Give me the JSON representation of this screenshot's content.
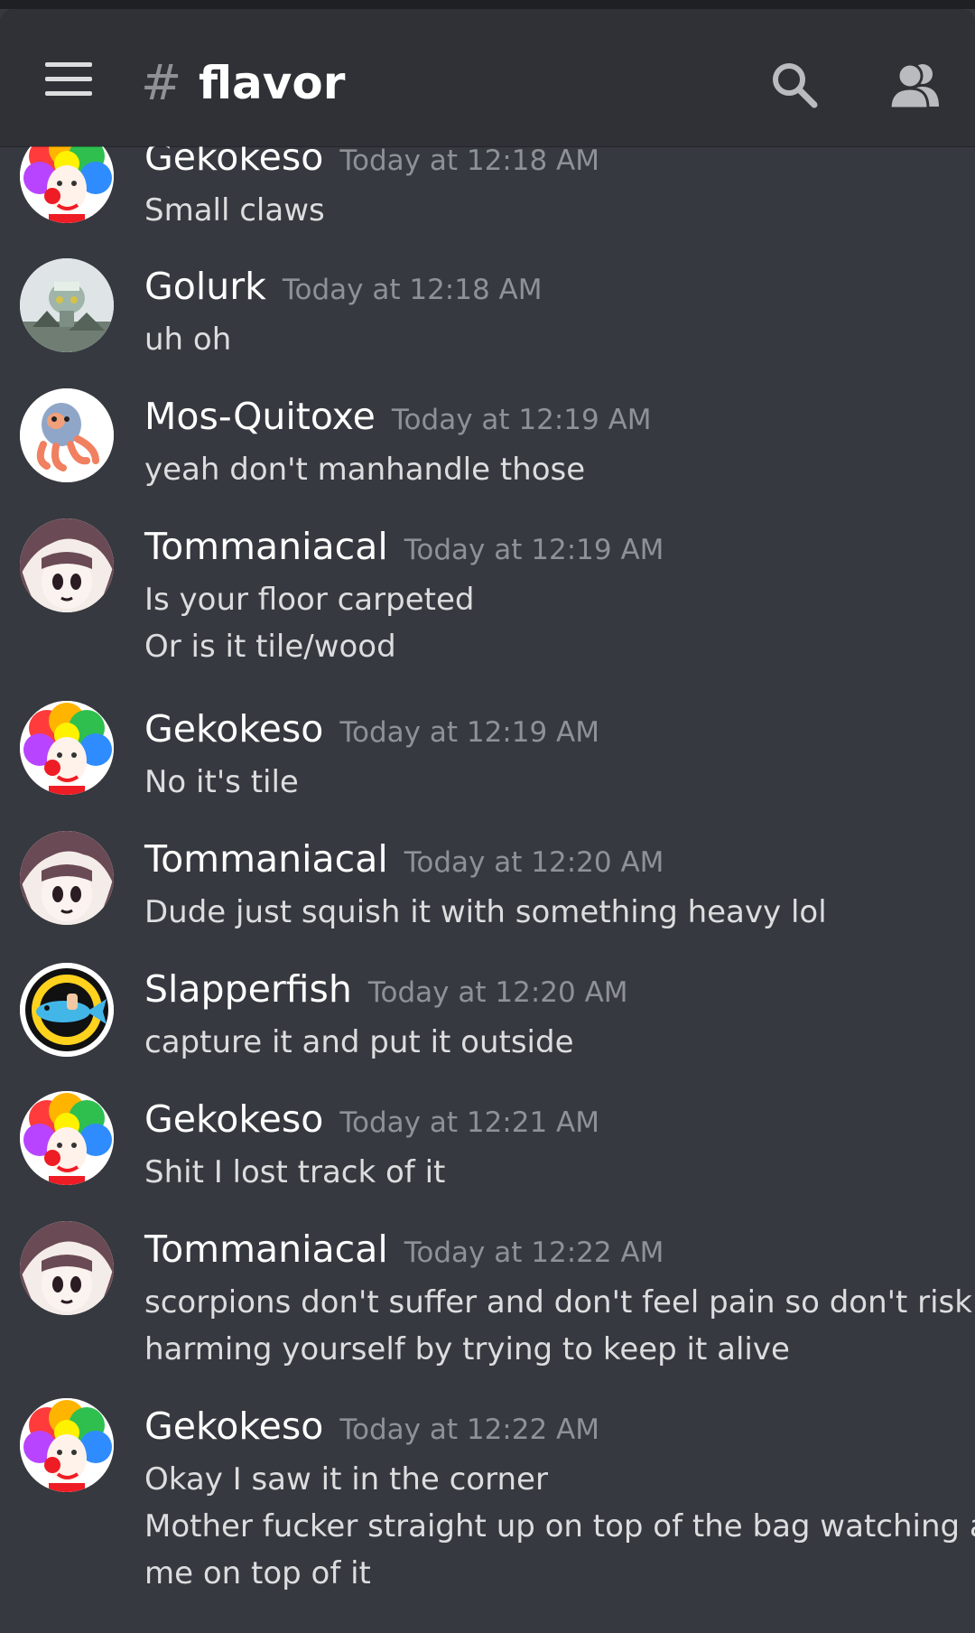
{
  "header": {
    "hash_symbol": "#",
    "channel_name": "flavor",
    "icons": [
      "hamburger-menu-icon",
      "search-icon",
      "members-icon"
    ]
  },
  "colors": {
    "background": "#36393f",
    "header_bg": "#2f3136",
    "username": "#ffffff",
    "timestamp": "#8e9297",
    "message_text": "#dcddde"
  },
  "messages": [
    {
      "username": "Gekokeso",
      "timestamp": "Today at 12:18 AM",
      "lines": [
        "Small claws"
      ],
      "avatar": "clown-avatar"
    },
    {
      "username": "Golurk",
      "timestamp": "Today at 12:18 AM",
      "lines": [
        "uh oh"
      ],
      "avatar": "golurk-avatar"
    },
    {
      "username": "Mos-Quitoxe",
      "timestamp": "Today at 12:19 AM",
      "lines": [
        "yeah don't manhandle those"
      ],
      "avatar": "octopus-avatar"
    },
    {
      "username": "Tommaniacal",
      "timestamp": "Today at 12:19 AM",
      "lines": [
        "Is your floor carpeted",
        "Or is it tile/wood"
      ],
      "avatar": "anime-girl-avatar"
    },
    {
      "username": "Gekokeso",
      "timestamp": "Today at 12:19 AM",
      "lines": [
        "No it's tile"
      ],
      "avatar": "clown-avatar"
    },
    {
      "username": "Tommaniacal",
      "timestamp": "Today at 12:20 AM",
      "lines": [
        "Dude just squish it with something heavy lol"
      ],
      "avatar": "anime-girl-avatar"
    },
    {
      "username": "Slapperfish",
      "timestamp": "Today at 12:20 AM",
      "lines": [
        "capture it and put it outside"
      ],
      "avatar": "fish-avatar"
    },
    {
      "username": "Gekokeso",
      "timestamp": "Today at 12:21 AM",
      "lines": [
        "Shit I lost track of it"
      ],
      "avatar": "clown-avatar"
    },
    {
      "username": "Tommaniacal",
      "timestamp": "Today at 12:22 AM",
      "lines": [
        "scorpions don't suffer and don't feel pain so don't risk",
        "harming yourself by trying to keep it alive"
      ],
      "avatar": "anime-girl-avatar"
    },
    {
      "username": "Gekokeso",
      "timestamp": "Today at 12:22 AM",
      "lines": [
        "Okay I saw it in the corner",
        "Mother fucker straight up on top of the bag watching at",
        "me on top of it"
      ],
      "avatar": "clown-avatar"
    }
  ]
}
